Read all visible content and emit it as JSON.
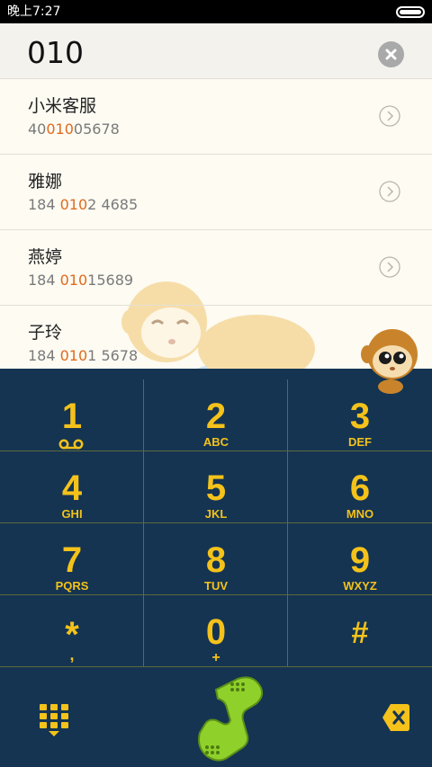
{
  "status_bar": {
    "time": "晚上7:27",
    "battery_level": 1.0
  },
  "search": {
    "query": "010"
  },
  "results": [
    {
      "name": "小米客服",
      "number_pre": "40",
      "number_match": "010",
      "number_post": "05678"
    },
    {
      "name": "雅娜",
      "number_pre": "184 ",
      "number_match": "010",
      "number_post": "2 4685"
    },
    {
      "name": "燕婷",
      "number_pre": "184 ",
      "number_match": "010",
      "number_post": "15689"
    },
    {
      "name": "子玲",
      "number_pre": "184 ",
      "number_match": "010",
      "number_post": "1 5678"
    }
  ],
  "keys": [
    {
      "digit": "1",
      "letters": ""
    },
    {
      "digit": "2",
      "letters": "ABC"
    },
    {
      "digit": "3",
      "letters": "DEF"
    },
    {
      "digit": "4",
      "letters": "GHI"
    },
    {
      "digit": "5",
      "letters": "JKL"
    },
    {
      "digit": "6",
      "letters": "MNO"
    },
    {
      "digit": "7",
      "letters": "PQRS"
    },
    {
      "digit": "8",
      "letters": "TUV"
    },
    {
      "digit": "9",
      "letters": "WXYZ"
    },
    {
      "digit": "*",
      "letters": ","
    },
    {
      "digit": "0",
      "letters": "+"
    },
    {
      "digit": "#",
      "letters": ""
    }
  ],
  "icons": {
    "clear": "clear-icon",
    "row_arrow": "chevron-right-icon",
    "voicemail": "voicemail-icon",
    "keypad_toggle": "keypad-icon",
    "call": "phone-handset-icon",
    "delete": "backspace-icon"
  },
  "colors": {
    "accent_highlight": "#e06a1f",
    "dialpad_bg": "#143452",
    "key_text": "#f4c21a",
    "call_green": "#8fd12a"
  }
}
